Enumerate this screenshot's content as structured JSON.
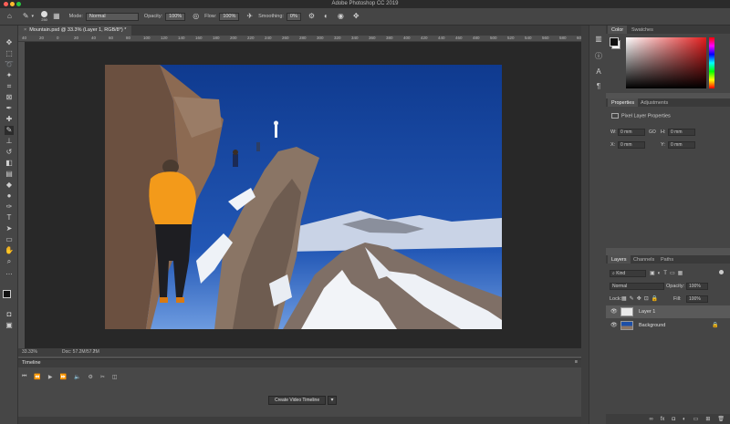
{
  "app": {
    "title": "Adobe Photoshop CC 2019"
  },
  "options_bar": {
    "brush_size": "250",
    "mode_label": "Mode:",
    "mode_value": "Normal",
    "opacity_label": "Opacity:",
    "opacity_value": "100%",
    "flow_label": "Flow:",
    "flow_value": "100%",
    "smoothing_label": "Smoothing:",
    "smoothing_value": "0%"
  },
  "document": {
    "tab_title": "Mountain.psd @ 33.3% (Layer 1, RGB/8*) *",
    "ruler_ticks": [
      "40",
      "20",
      "0",
      "20",
      "40",
      "60",
      "80",
      "100",
      "120",
      "140",
      "160",
      "180",
      "200",
      "220",
      "240",
      "260",
      "280",
      "300",
      "320",
      "340",
      "360",
      "380",
      "400",
      "420",
      "440",
      "460",
      "480",
      "500",
      "520",
      "540",
      "560",
      "580",
      "600"
    ],
    "zoom": "33.33%",
    "doc_info": "Doc: 57.2M/57.2M"
  },
  "timeline": {
    "title": "Timeline",
    "create_label": "Create Video Timeline"
  },
  "color_panel": {
    "tabs": [
      "Color",
      "Swatches"
    ]
  },
  "properties_panel": {
    "tabs": [
      "Properties",
      "Adjustments"
    ],
    "subtitle": "Pixel Layer Properties",
    "w_label": "W:",
    "w_value": "0 mm",
    "h_label": "H:",
    "h_value": "0 mm",
    "link_label": "GO",
    "x_label": "X:",
    "x_value": "0 mm",
    "y_label": "Y:",
    "y_value": "0 mm"
  },
  "layers_panel": {
    "tabs": [
      "Layers",
      "Channels",
      "Paths"
    ],
    "filter_label": "Kind",
    "blend_mode": "Normal",
    "opacity_label": "Opacity:",
    "opacity_value": "100%",
    "lock_label": "Lock:",
    "fill_label": "Fill:",
    "fill_value": "100%",
    "layers": [
      {
        "name": "Layer 1",
        "selected": true
      },
      {
        "name": "Background",
        "selected": false
      }
    ],
    "bottom_icons": [
      "link-icon",
      "fx-icon",
      "mask-icon",
      "adjustment-icon",
      "folder-icon",
      "new-layer-icon",
      "trash-icon"
    ]
  },
  "colors": {
    "sky": "#1d4fa8",
    "jacket": "#f39a1a",
    "panel_bg": "#454545",
    "canvas_bg": "#282828"
  }
}
